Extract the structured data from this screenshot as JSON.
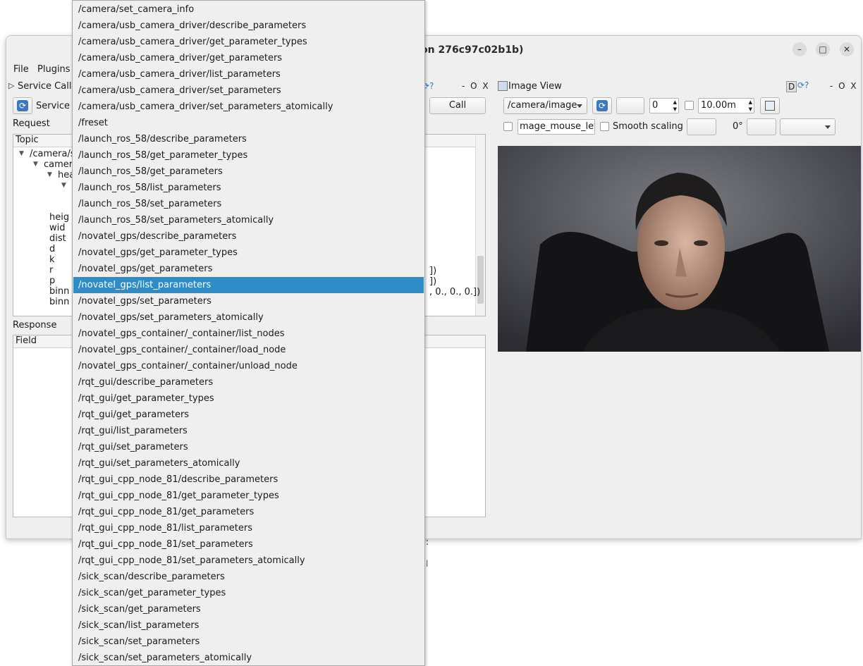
{
  "window": {
    "title": "on 276c97c02b1b)",
    "minimize_glyph": "–",
    "maximize_glyph": "□",
    "close_glyph": "✕"
  },
  "menu": {
    "file": "File",
    "plugins": "Plugins"
  },
  "service_caller": {
    "panel_title": "Service Calle",
    "service_label": "Service",
    "call_label": "Call",
    "dock_controls": "- O X",
    "request_label": "Request",
    "response_label": "Response",
    "request_header": "Topic",
    "response_header": "Field",
    "request_rows": [
      {
        "label": "/camera/se",
        "indent": 0,
        "expanded": true
      },
      {
        "label": "camera",
        "indent": 1,
        "expanded": true
      },
      {
        "label": "hea",
        "indent": 2,
        "expanded": true
      },
      {
        "label": "",
        "indent": 3,
        "expanded": true
      },
      {
        "label": "",
        "indent": 3,
        "expanded": false
      },
      {
        "label": "",
        "indent": 3,
        "expanded": false
      },
      {
        "label": "heig",
        "indent": 2,
        "expanded": false
      },
      {
        "label": "wid",
        "indent": 2,
        "expanded": false
      },
      {
        "label": "dist",
        "indent": 2,
        "expanded": false
      },
      {
        "label": "d",
        "indent": 2,
        "expanded": false
      },
      {
        "label": "k",
        "indent": 2,
        "expanded": false
      },
      {
        "label": "r",
        "indent": 2,
        "expanded": false
      },
      {
        "label": "p",
        "indent": 2,
        "expanded": false
      },
      {
        "label": "binn",
        "indent": 2,
        "expanded": false
      },
      {
        "label": "binn",
        "indent": 2,
        "expanded": false
      }
    ],
    "value_fragments": [
      "])",
      "])",
      ", 0., 0., 0.])"
    ]
  },
  "image_view": {
    "panel_title": "Image View",
    "dock_controls": "- O X",
    "topic": "/camera/image",
    "spin_value": "0",
    "duration": "10.00m",
    "mouse_topic": "mage_mouse_left",
    "smooth_scaling": "Smooth scaling",
    "rotation": "0°",
    "d_badge": "D"
  },
  "dropdown": {
    "selected_index": 17,
    "items": [
      "/camera/set_camera_info",
      "/camera/usb_camera_driver/describe_parameters",
      "/camera/usb_camera_driver/get_parameter_types",
      "/camera/usb_camera_driver/get_parameters",
      "/camera/usb_camera_driver/list_parameters",
      "/camera/usb_camera_driver/set_parameters",
      "/camera/usb_camera_driver/set_parameters_atomically",
      "/freset",
      "/launch_ros_58/describe_parameters",
      "/launch_ros_58/get_parameter_types",
      "/launch_ros_58/get_parameters",
      "/launch_ros_58/list_parameters",
      "/launch_ros_58/set_parameters",
      "/launch_ros_58/set_parameters_atomically",
      "/novatel_gps/describe_parameters",
      "/novatel_gps/get_parameter_types",
      "/novatel_gps/get_parameters",
      "/novatel_gps/list_parameters",
      "/novatel_gps/set_parameters",
      "/novatel_gps/set_parameters_atomically",
      "/novatel_gps_container/_container/list_nodes",
      "/novatel_gps_container/_container/load_node",
      "/novatel_gps_container/_container/unload_node",
      "/rqt_gui/describe_parameters",
      "/rqt_gui/get_parameter_types",
      "/rqt_gui/get_parameters",
      "/rqt_gui/list_parameters",
      "/rqt_gui/set_parameters",
      "/rqt_gui/set_parameters_atomically",
      "/rqt_gui_cpp_node_81/describe_parameters",
      "/rqt_gui_cpp_node_81/get_parameter_types",
      "/rqt_gui_cpp_node_81/get_parameters",
      "/rqt_gui_cpp_node_81/list_parameters",
      "/rqt_gui_cpp_node_81/set_parameters",
      "/rqt_gui_cpp_node_81/set_parameters_atomically",
      "/sick_scan/describe_parameters",
      "/sick_scan/get_parameter_types",
      "/sick_scan/get_parameters",
      "/sick_scan/list_parameters",
      "/sick_scan/set_parameters",
      "/sick_scan/set_parameters_atomically"
    ]
  },
  "colors": {
    "selection": "#308cc6",
    "accent": "#3b78c4"
  }
}
